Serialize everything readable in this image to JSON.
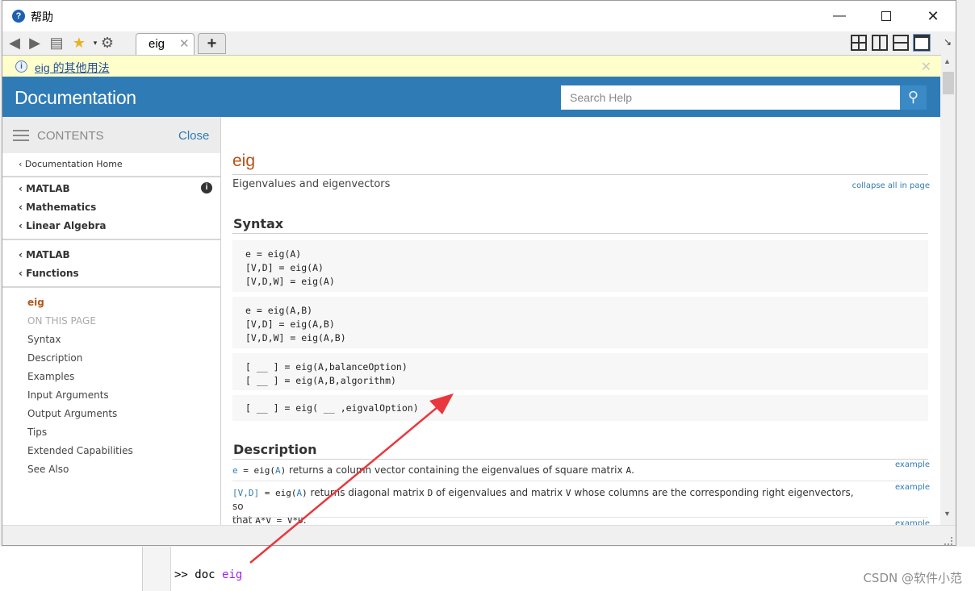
{
  "window": {
    "title": "帮助"
  },
  "toolbar": {
    "tab_label": "eig",
    "tab_close": "✕",
    "add_tab": "+"
  },
  "infobar": {
    "link": "eig 的其他用法"
  },
  "header": {
    "title": "Documentation",
    "search_placeholder": "Search Help"
  },
  "sidebar": {
    "contents_label": "CONTENTS",
    "close_label": "Close",
    "doc_home": "Documentation Home",
    "crumbs1": [
      "MATLAB",
      "Mathematics",
      "Linear Algebra"
    ],
    "crumbs2": [
      "MATLAB",
      "Functions"
    ],
    "current": "eig",
    "on_this_page": "ON THIS PAGE",
    "page_items": [
      "Syntax",
      "Description",
      "Examples",
      "Input Arguments",
      "Output Arguments",
      "Tips",
      "Extended Capabilities",
      "See Also"
    ]
  },
  "content": {
    "function_name": "eig",
    "purpose": "Eigenvalues and eigenvectors",
    "collapse_all": "collapse all in page",
    "syntax_heading": "Syntax",
    "syntax_blocks": [
      [
        "e = eig(A)",
        "[V,D] = eig(A)",
        "[V,D,W] = eig(A)"
      ],
      [
        "e = eig(A,B)",
        "[V,D] = eig(A,B)",
        "[V,D,W] = eig(A,B)"
      ],
      [
        "[ __ ] = eig(A,balanceOption)",
        "[ __ ] = eig(A,B,algorithm)"
      ],
      [
        "[ __ ] = eig( __ ,eigvalOption)"
      ]
    ],
    "description_heading": "Description",
    "desc1": {
      "code_out": "e",
      "code_mid": " = eig(",
      "code_arg": "A",
      "code_end": ")",
      "text": " returns a column vector containing the eigenvalues of square matrix ",
      "mono_tail": "A",
      "end": "."
    },
    "desc2": {
      "code_out": "[V,D]",
      "code_mid": " = eig(",
      "code_arg": "A",
      "code_end": ")",
      "text1": " returns diagonal matrix ",
      "mono1": "D",
      "text2": " of eigenvalues and matrix ",
      "mono2": "V",
      "text3": " whose columns are the corresponding right eigenvectors, so",
      "text4": "that ",
      "mono3": "A*V = V*D",
      "end": "."
    },
    "example_label": "example"
  },
  "command_window": {
    "prompt": ">>",
    "command": "doc",
    "argument": "eig"
  },
  "watermark": "CSDN @软件小范",
  "colors": {
    "accent": "#2f7bb6",
    "function_name": "#b55116",
    "arrow": "#e8383d"
  }
}
